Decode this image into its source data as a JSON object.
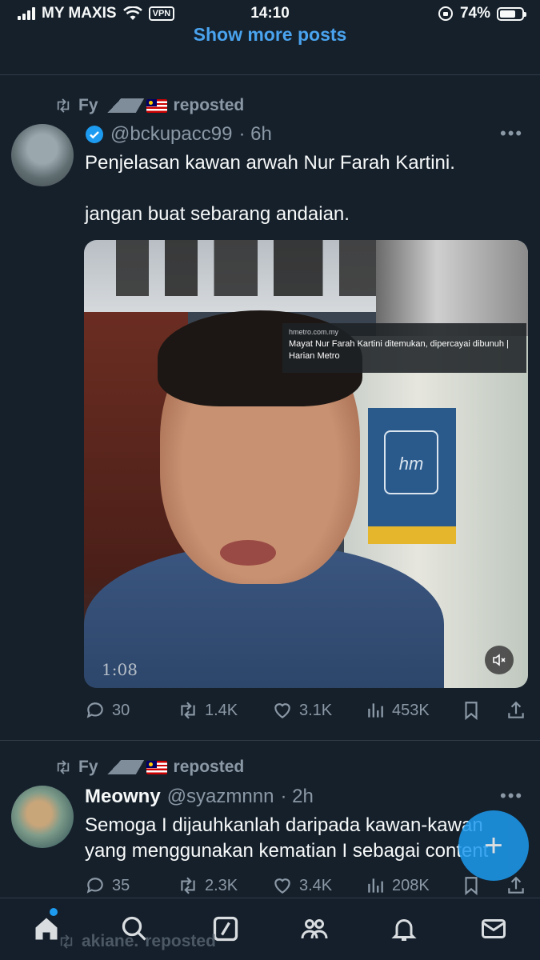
{
  "status_bar": {
    "carrier": "MY MAXIS",
    "vpn": "VPN",
    "time": "14:10",
    "battery": "74%",
    "battery_level": 0.74
  },
  "feed": {
    "show_more": "Show more posts"
  },
  "tweets": [
    {
      "repost_by": "Fy",
      "repost_label": "reposted",
      "handle": "@bckupacc99",
      "time": "· 6h",
      "text": "Penjelasan kawan arwah Nur Farah Kartini.\n\njangan buat sebarang andaian.",
      "media": {
        "caption_source": "hmetro.com.my",
        "caption_title": "Mayat Nur Farah Kartini ditemukan, dipercayai dibunuh | Harian Metro",
        "duration": "1:08"
      },
      "replies": "30",
      "reposts": "1.4K",
      "likes": "3.1K",
      "views": "453K"
    },
    {
      "repost_by": "Fy",
      "repost_label": "reposted",
      "name": "Meowny",
      "handle": "@syazmnnn",
      "time": "· 2h",
      "text": "Semoga I dijauhkanlah daripada kawan-kawan yang menggunakan kematian I sebagai content",
      "replies": "35",
      "reposts": "2.3K",
      "likes": "3.4K",
      "views": "208K"
    }
  ],
  "peek_repost": {
    "name": "akiane.",
    "label": "reposted"
  },
  "colors": {
    "background": "#15202b",
    "accent": "#1d9bf0",
    "muted": "#8b98a5",
    "link": "#4aa3ee"
  }
}
